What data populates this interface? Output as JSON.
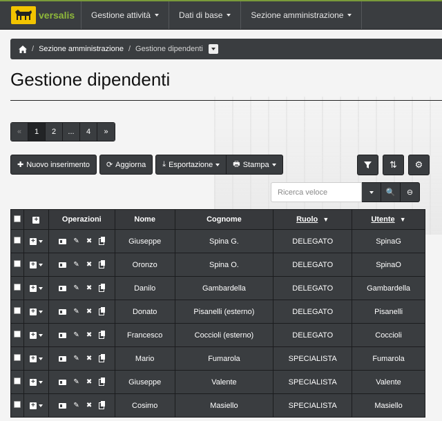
{
  "navbar": {
    "brand": "versalis",
    "menus": [
      {
        "label": "Gestione attività"
      },
      {
        "label": "Dati di base"
      },
      {
        "label": "Sezione amministrazione"
      }
    ]
  },
  "breadcrumb": {
    "items": [
      "Sezione amministrazione",
      "Gestione dipendenti"
    ]
  },
  "page": {
    "title": "Gestione dipendenti"
  },
  "pagination": {
    "prev": "«",
    "pages": [
      "1",
      "2",
      "...",
      "4"
    ],
    "next": "»",
    "active": "1"
  },
  "toolbar": {
    "new_label": "Nuovo inserimento",
    "refresh_label": "Aggiorna",
    "export_label": "Esportazione",
    "print_label": "Stampa"
  },
  "search": {
    "placeholder": "Ricerca veloce"
  },
  "table": {
    "headers": {
      "operations": "Operazioni",
      "nome": "Nome",
      "cognome": "Cognome",
      "ruolo": "Ruolo",
      "utente": "Utente"
    },
    "rows": [
      {
        "nome": "Giuseppe",
        "cognome": "Spina G.",
        "ruolo": "DELEGATO",
        "utente": "SpinaG"
      },
      {
        "nome": "Oronzo",
        "cognome": "Spina O.",
        "ruolo": "DELEGATO",
        "utente": "SpinaO"
      },
      {
        "nome": "Danilo",
        "cognome": "Gambardella",
        "ruolo": "DELEGATO",
        "utente": "Gambardella"
      },
      {
        "nome": "Donato",
        "cognome": "Pisanelli (esterno)",
        "ruolo": "DELEGATO",
        "utente": "Pisanelli"
      },
      {
        "nome": "Francesco",
        "cognome": "Coccioli (esterno)",
        "ruolo": "DELEGATO",
        "utente": "Coccioli"
      },
      {
        "nome": "Mario",
        "cognome": "Fumarola",
        "ruolo": "SPECIALISTA",
        "utente": "Fumarola"
      },
      {
        "nome": "Giuseppe",
        "cognome": "Valente",
        "ruolo": "SPECIALISTA",
        "utente": "Valente"
      },
      {
        "nome": "Cosimo",
        "cognome": "Masiello",
        "ruolo": "SPECIALISTA",
        "utente": "Masiello"
      }
    ]
  }
}
